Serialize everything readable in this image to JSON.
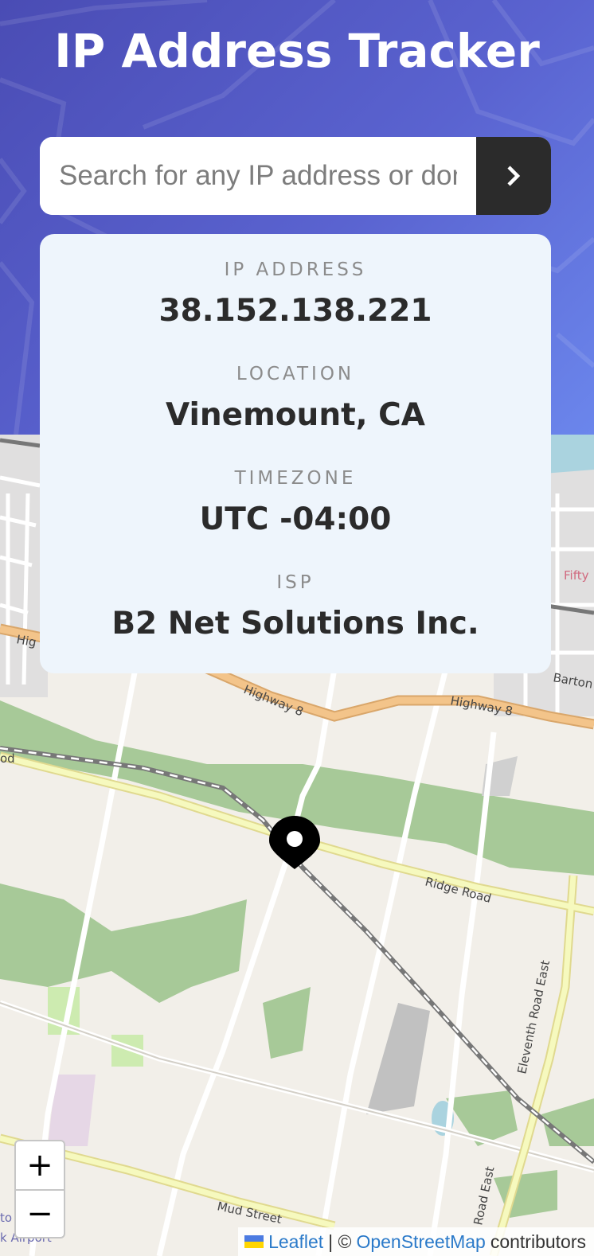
{
  "header": {
    "title": "IP Address Tracker"
  },
  "search": {
    "placeholder": "Search for any IP address or domain",
    "submit_icon": "chevron-right-icon"
  },
  "info": {
    "ip_label": "IP ADDRESS",
    "ip_value": "38.152.138.221",
    "location_label": "LOCATION",
    "location_value": "Vinemount, CA",
    "timezone_label": "TIMEZONE",
    "timezone_value": "UTC -04:00",
    "isp_label": "ISP",
    "isp_value": "B2 Net Solutions Inc."
  },
  "map": {
    "road_labels": [
      "Highway 8",
      "Highway 8",
      "Ridge Road",
      "Eleventh Road East",
      "Mud Street",
      "Barton",
      "Fifty",
      "Hig",
      "od",
      "Road East",
      "to",
      "k Airport"
    ],
    "zoom_in": "+",
    "zoom_out": "−",
    "marker_icon": "location-pin-icon"
  },
  "attribution": {
    "leaflet": "Leaflet",
    "separator": "| ©",
    "osm": "OpenStreetMap",
    "contributors": "contributors"
  },
  "colors": {
    "header_gradient_start": "#4a4cb4",
    "header_gradient_end": "#6b86ec",
    "button_dark": "#2b2b2b",
    "card_bg": "#eef5fc",
    "map_bg": "#f2efe9",
    "forest": "#a7c998",
    "road_yellow": "#f6f9be",
    "highway_orange": "#f3c48a",
    "water": "#aad3df",
    "link": "#2b7ac9"
  }
}
